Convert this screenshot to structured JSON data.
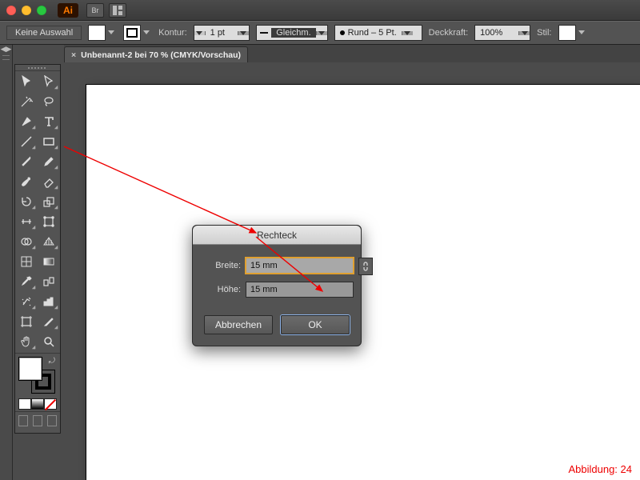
{
  "titlebar": {
    "app_badge": "Ai",
    "bridge_label": "Br"
  },
  "control": {
    "selection": "Keine Auswahl",
    "kontur_label": "Kontur:",
    "stroke_weight": "1 pt",
    "dash_label": "Gleichm.",
    "profile_label": "Rund – 5 Pt.",
    "opacity_label": "Deckkraft:",
    "opacity_value": "100%",
    "style_label": "Stil:"
  },
  "doc_tab": {
    "close": "×",
    "label": "Unbenannt-2 bei 70 % (CMYK/Vorschau)"
  },
  "dialog": {
    "title": "Rechteck",
    "width_label": "Breite:",
    "width_value": "15 mm",
    "height_label": "Höhe:",
    "height_value": "15 mm",
    "cancel": "Abbrechen",
    "ok": "OK"
  },
  "caption": "Abbildung: 24",
  "expand_handle": "◀▶"
}
